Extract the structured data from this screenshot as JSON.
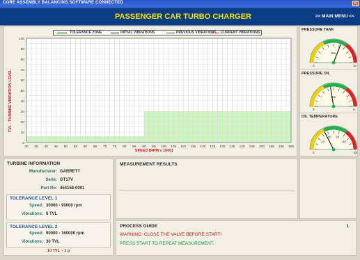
{
  "window": {
    "title": "CORE ASSEMBLY BALANCING SOFTWARE   CONNECTED"
  },
  "header": {
    "title": "PASSENGER CAR TURBO CHARGER",
    "menu": ">> MAIN MENU <<"
  },
  "chart": {
    "legend": [
      "TOLERANCE ZONE",
      "INITIAL VIBRATIONS",
      "PREVIOUS VIBRATIONS",
      "CURRENT VIBRATIONS"
    ],
    "ylabel": "TVL - TURBINE VIBRATION LEVEL",
    "xlabel": "SPEED [RPM x 1000]"
  },
  "chart_data": {
    "type": "area",
    "xlabel": "SPEED [RPM x 1000]",
    "ylabel": "TVL - TURBINE VIBRATION LEVEL",
    "xlim": [
      30,
      165
    ],
    "ylim": [
      0,
      100
    ],
    "x_ticks": [
      30,
      35,
      40,
      45,
      50,
      55,
      60,
      65,
      70,
      75,
      80,
      85,
      90,
      95,
      100,
      105,
      110,
      115,
      120,
      125,
      130,
      135,
      140,
      145,
      150,
      155,
      160,
      165
    ],
    "y_ticks": [
      0,
      10,
      20,
      30,
      40,
      50,
      60,
      70,
      80,
      90,
      100
    ],
    "grid": true,
    "legend_position": "top",
    "series": [
      {
        "name": "TOLERANCE ZONE",
        "x": [
          30,
          90,
          90,
          165
        ],
        "y": [
          6,
          6,
          30,
          30
        ]
      },
      {
        "name": "INITIAL VIBRATIONS",
        "x": [],
        "y": []
      },
      {
        "name": "PREVIOUS VIBRATIONS",
        "x": [],
        "y": []
      },
      {
        "name": "CURRENT VIBRATIONS",
        "x": [],
        "y": []
      }
    ],
    "colors": {
      "tolerance": "#ccf5c0",
      "initial": "#000000",
      "previous": "#3a3a3a",
      "current": "#d01818"
    }
  },
  "gauges": [
    {
      "title": "PRESSURE TANK",
      "unit": "Bar",
      "min": "0",
      "max": "10",
      "level": 0.62
    },
    {
      "title": "PRESSURE OIL",
      "unit": "Bar",
      "min": "0",
      "max": "6",
      "level": 0.45
    },
    {
      "title": "OIL TEMPERATURE",
      "unit": "",
      "min": "0",
      "max": "100",
      "level": 0.35,
      "ticks": [
        "20",
        "40",
        "60",
        "80"
      ]
    }
  ],
  "turbine": {
    "title": "TURBINE INFORMATION",
    "manufacturer_label": "Manufacturer:",
    "manufacturer": "GARRETT",
    "serie_label": "Serie:",
    "serie": "GT17V",
    "part_label": "Part No:",
    "part": "454158-0001",
    "tol1_title": "TOLERANCE LEVEL 1",
    "tol1_speed_label": "Speed:",
    "tol1_speed": "30000 - 90000 rpm",
    "tol1_vib_label": "Vibrations:",
    "tol1_vib": "6 TVL",
    "tol2_title": "TOLERANCE LEVEL 2",
    "tol2_speed_label": "Speed:",
    "tol2_speed": "90000 - 160000 rpm",
    "tol2_vib_label": "Vibrations:",
    "tol2_vib": "30 TVL",
    "footnote": "10 TVL ~ 1 g"
  },
  "measurement": {
    "title": "MEASUREMENT RESULTS"
  },
  "guide": {
    "title": "PROCESS GUIDE",
    "step": "1",
    "warning": "WARNING: CLOSE THE VALVE BEFORE START!",
    "instruction": "PRESS START TO REPEAT MEASUREMENT."
  }
}
